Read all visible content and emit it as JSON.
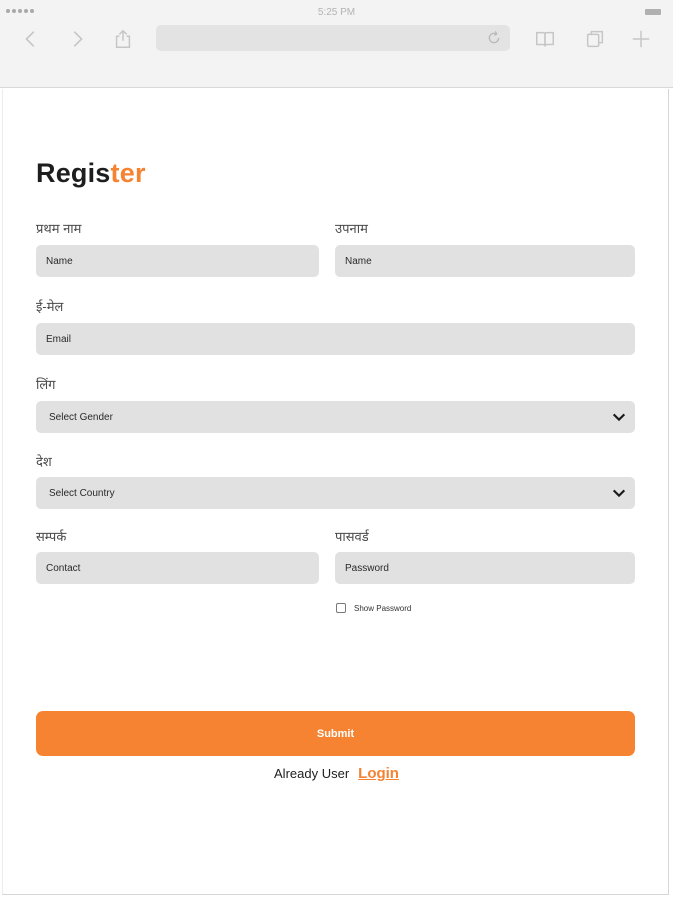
{
  "browser": {
    "status_time": "5:25 PM",
    "icons": {
      "back": "chevron-left-icon",
      "forward": "chevron-right-icon",
      "share": "share-icon",
      "reload": "reload-icon",
      "reader": "book-icon",
      "tabs": "tabs-icon",
      "new_tab": "plus-icon"
    },
    "address_value": ""
  },
  "form": {
    "title_prefix": "Regis",
    "title_suffix": "ter",
    "accent_color": "#f68332",
    "first_name": {
      "label": "प्रथम नाम",
      "placeholder": "Name"
    },
    "last_name": {
      "label": "उपनाम",
      "placeholder": "Name"
    },
    "email": {
      "label": "ई-मेल",
      "placeholder": "Email"
    },
    "gender": {
      "label": "लिंग",
      "selected": "Select Gender"
    },
    "country": {
      "label": "देश",
      "selected": "Select Country"
    },
    "contact": {
      "label": "सम्पर्क",
      "placeholder": "Contact"
    },
    "password": {
      "label": "पासवर्ड",
      "placeholder": "Password"
    },
    "show_password": {
      "label": "Show Password",
      "checked": false
    },
    "submit_label": "Submit",
    "already_user_text": "Already User",
    "login_link": "Login"
  }
}
